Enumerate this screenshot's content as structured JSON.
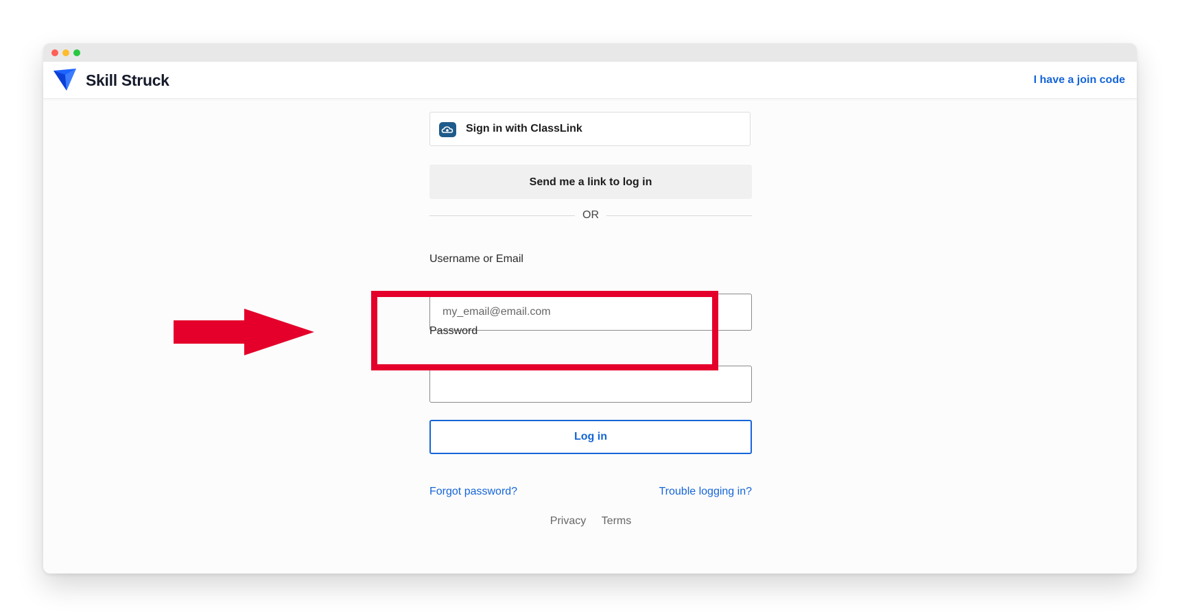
{
  "window": {
    "controls": [
      "close",
      "minimize",
      "zoom"
    ]
  },
  "header": {
    "brand": "Skill Struck",
    "logo_icon": "shield-triangle-logo",
    "join_link": "I have a join code"
  },
  "signin": {
    "classlink_label": "Sign in with ClassLink",
    "classlink_icon": "cloud-icon",
    "magic_link_label": "Send me a link to log in",
    "divider_text": "OR"
  },
  "form": {
    "username_label": "Username or Email",
    "username_placeholder": "my_email@email.com",
    "username_value": "",
    "password_label": "Password",
    "password_value": "",
    "login_label": "Log in"
  },
  "links": {
    "forgot": "Forgot password?",
    "trouble": "Trouble logging in?"
  },
  "footer": {
    "privacy": "Privacy",
    "terms": "Terms"
  },
  "annotation": {
    "highlight_color": "#e4002b",
    "arrow_icon": "arrow-right-icon"
  },
  "colors": {
    "accent": "#1565d8",
    "brand_logo": "#1d63ff"
  }
}
